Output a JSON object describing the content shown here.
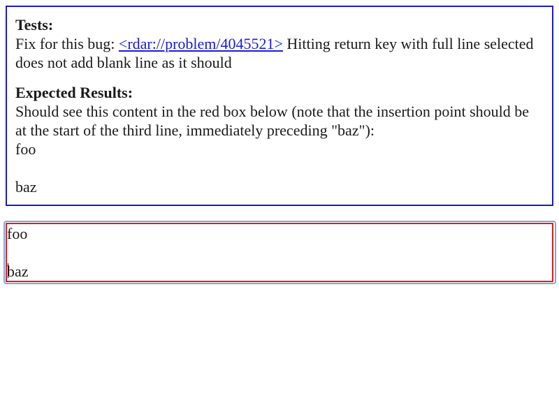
{
  "explanation": {
    "tests_heading": "Tests:",
    "tests_prefix": "Fix for this bug: ",
    "bug_link": "<rdar://problem/4045521>",
    "tests_suffix": " Hitting return key with full line selected does not add blank line as it should",
    "expected_heading": "Expected Results:",
    "expected_text": "Should see this content in the red box below (note that the insertion point should be at the start of the third line, immediately preceding \"baz\"):",
    "expected_lines": [
      "foo",
      "",
      "baz"
    ]
  },
  "editor": {
    "lines": [
      "foo",
      "",
      "baz"
    ]
  },
  "colors": {
    "explanation_border": "#1a1acc",
    "editor_border": "#e01b1b",
    "focus_ring": "#7fa7e0",
    "link": "#1a1adb"
  }
}
